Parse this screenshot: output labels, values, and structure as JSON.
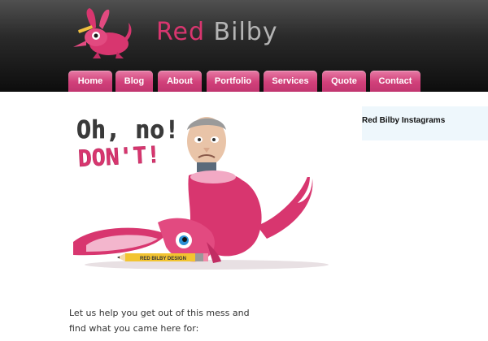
{
  "brand": {
    "name_part1": "Red",
    "name_part2": "Bilby",
    "colors": {
      "pink": "#d8366f",
      "gray": "#b4b4b4"
    },
    "logo_icon": "bilby-mascot-icon"
  },
  "nav": {
    "items": [
      {
        "label": "Home"
      },
      {
        "label": "Blog"
      },
      {
        "label": "About"
      },
      {
        "label": "Portfolio"
      },
      {
        "label": "Services"
      },
      {
        "label": "Quote"
      },
      {
        "label": "Contact"
      }
    ]
  },
  "hero": {
    "line1": "Oh, no!",
    "line2": "DON'T!",
    "pencil_text": "RED BILBY DESIGN"
  },
  "sidebar": {
    "title": "Red Bilby Instagrams"
  },
  "main": {
    "message_line1": "Let us help you get out of this mess and",
    "message_line2": "find what you came here for:"
  }
}
